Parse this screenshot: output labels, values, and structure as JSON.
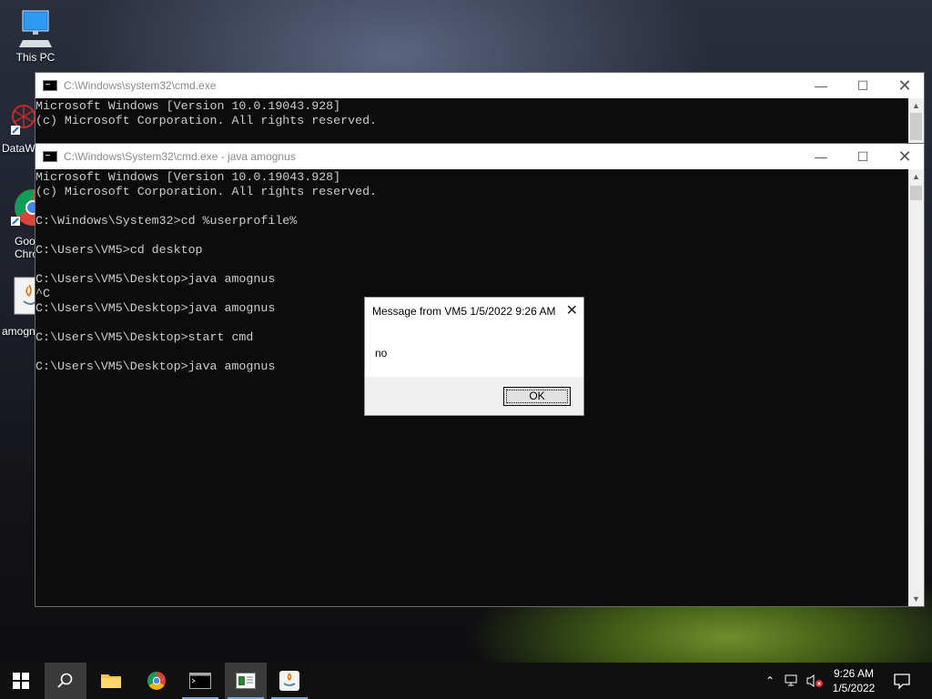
{
  "desktop": {
    "icons": [
      {
        "label": "This PC"
      },
      {
        "label": "DataW"
      },
      {
        "label": "Goo\nChro"
      },
      {
        "label": "amogn"
      }
    ]
  },
  "window_back": {
    "title": "C:\\Windows\\system32\\cmd.exe",
    "lines": "Microsoft Windows [Version 10.0.19043.928]\n(c) Microsoft Corporation. All rights reserved."
  },
  "window_front": {
    "title": "C:\\Windows\\System32\\cmd.exe - java  amognus",
    "lines": "Microsoft Windows [Version 10.0.19043.928]\n(c) Microsoft Corporation. All rights reserved.\n\nC:\\Windows\\System32>cd %userprofile%\n\nC:\\Users\\VM5>cd desktop\n\nC:\\Users\\VM5\\Desktop>java amognus\n^C\nC:\\Users\\VM5\\Desktop>java amognus\n\nC:\\Users\\VM5\\Desktop>start cmd\n\nC:\\Users\\VM5\\Desktop>java amognus"
  },
  "dialog": {
    "title": "Message from VM5 1/5/2022 9:26 AM",
    "message": "no",
    "ok_label": "OK"
  },
  "taskbar": {
    "clock_time": "9:26 AM",
    "clock_date": "1/5/2022"
  },
  "icons": {
    "start": "windows-logo",
    "search": "magnifier",
    "minimize": "minus",
    "maximize": "square",
    "close": "x"
  }
}
